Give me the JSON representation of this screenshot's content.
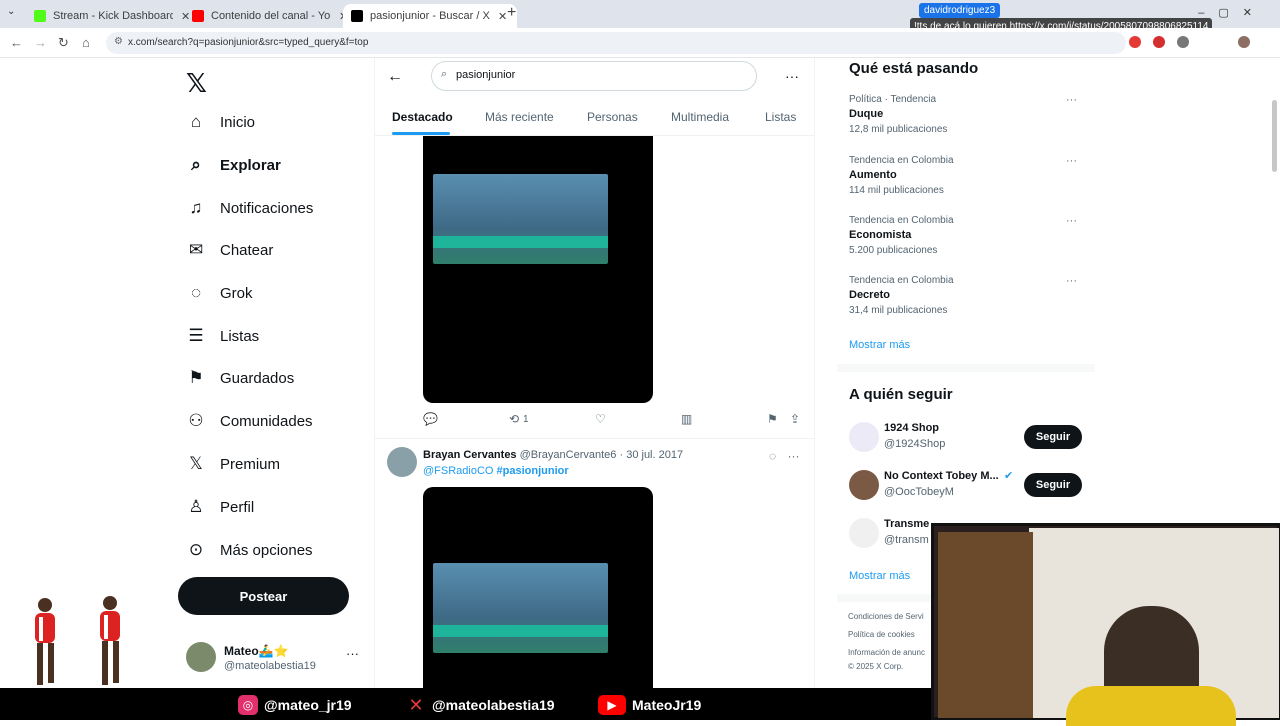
{
  "browser": {
    "tabs": [
      {
        "title": "Stream - Kick Dashboard",
        "color": "#53fc18",
        "active": false
      },
      {
        "title": "Contenido del canal - YouTube",
        "color": "#ff0000",
        "active": false
      },
      {
        "title": "pasionjunior - Buscar / X",
        "color": "#000000",
        "active": true
      }
    ],
    "url": "x.com/search?q=pasionjunior&src=typed_query&f=top"
  },
  "stream_overlay": {
    "chat_user": "davidrodriguez3",
    "chat_message": "!tts de acá lo quieren https://x.com/i/status/2005807098806825114"
  },
  "nav": {
    "items": [
      {
        "label": "Inicio",
        "icon": "⌂",
        "bold": false
      },
      {
        "label": "Explorar",
        "icon": "⌕",
        "bold": true
      },
      {
        "label": "Notificaciones",
        "icon": "🔔",
        "bold": false
      },
      {
        "label": "Chatear",
        "icon": "✉",
        "bold": false
      },
      {
        "label": "Grok",
        "icon": "◌",
        "bold": false
      },
      {
        "label": "Listas",
        "icon": "☰",
        "bold": false
      },
      {
        "label": "Guardados",
        "icon": "⚑",
        "bold": false
      },
      {
        "label": "Comunidades",
        "icon": "👥",
        "bold": false
      },
      {
        "label": "Premium",
        "icon": "𝕏",
        "bold": false
      },
      {
        "label": "Perfil",
        "icon": "👤",
        "bold": false
      },
      {
        "label": "Más opciones",
        "icon": "⋯",
        "bold": false
      }
    ],
    "post_label": "Postear",
    "profile": {
      "name": "Mateo🚣‍♂️⭐",
      "handle": "@mateolabestia19"
    }
  },
  "search": {
    "query": "pasionjunior",
    "tabs": [
      "Destacado",
      "Más reciente",
      "Personas",
      "Multimedia",
      "Listas"
    ],
    "active_tab": "Destacado"
  },
  "tweet1": {
    "retweets": "1"
  },
  "tweet2": {
    "name": "Brayan Cervantes",
    "handle": "@BrayanCervante6",
    "date": "30 jul. 2017",
    "mention": "@FSRadioCO",
    "hashtag": "#pasionjunior"
  },
  "trending": {
    "header": "Qué está pasando",
    "items": [
      {
        "context": "Política · Tendencia",
        "topic": "Duque",
        "posts": "12,8 mil publicaciones"
      },
      {
        "context": "Tendencia en Colombia",
        "topic": "Aumento",
        "posts": "114 mil publicaciones"
      },
      {
        "context": "Tendencia en Colombia",
        "topic": "Economista",
        "posts": "5.200 publicaciones"
      },
      {
        "context": "Tendencia en Colombia",
        "topic": "Decreto",
        "posts": "31,4 mil publicaciones"
      }
    ],
    "show_more": "Mostrar más"
  },
  "follow": {
    "header": "A quién seguir",
    "items": [
      {
        "name": "1924 Shop",
        "handle": "@1924Shop",
        "button": "Seguir"
      },
      {
        "name": "No Context Tobey M...",
        "handle": "@OocTobeyM",
        "button": "Seguir"
      },
      {
        "name": "Transme",
        "handle": "@transm",
        "button": ""
      }
    ],
    "show_more": "Mostrar más"
  },
  "footer": {
    "links": "Condiciones de Servi",
    "cookies": "Política de cookies",
    "ads": "Información de anunc",
    "copyright": "© 2025 X Corp."
  },
  "social_bar": {
    "instagram": "@mateo_jr19",
    "x": "@mateolabestia19",
    "youtube": "MateoJr19"
  }
}
